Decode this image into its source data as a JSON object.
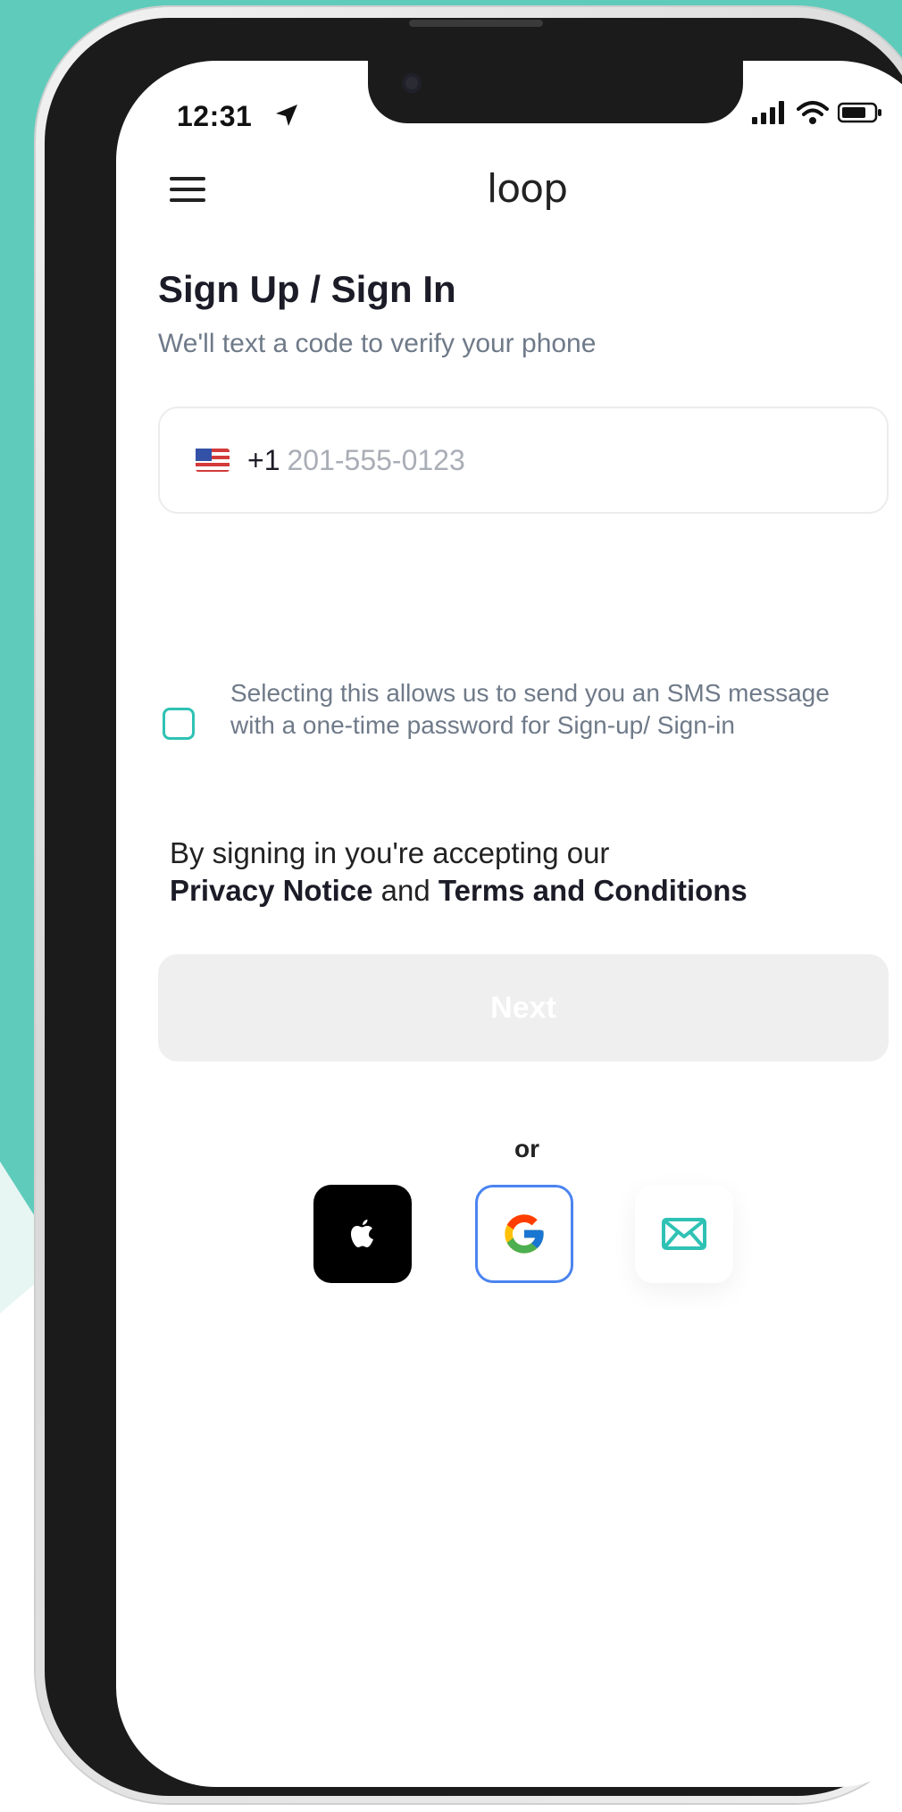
{
  "status_bar": {
    "time": "12:31"
  },
  "header": {
    "logo_text": "loop"
  },
  "auth": {
    "title": "Sign Up / Sign In",
    "subtitle": "We'll text a code to verify your phone",
    "phone": {
      "country_code": "+1",
      "placeholder": "201-555-0123",
      "value": ""
    },
    "sms_consent": {
      "checked": false,
      "text": "Selecting this allows us to send you an SMS message with a one-time password for Sign-up/ Sign-in"
    },
    "legal": {
      "prefix": "By signing in you're accepting our",
      "privacy_label": "Privacy Notice",
      "joiner": "and",
      "terms_label": "Terms and Conditions"
    },
    "next_label": "Next",
    "or_label": "or"
  },
  "colors": {
    "teal": "#5fcbbb",
    "accent": "#2fc2b4",
    "google_border": "#4b84f0",
    "disabled_button": "#efefef"
  },
  "icons": {
    "menu": "hamburger-icon",
    "location": "location-arrow-icon",
    "signal": "signal-icon",
    "wifi": "wifi-icon",
    "battery": "battery-icon",
    "flag": "us-flag-icon",
    "apple": "apple-icon",
    "google": "google-icon",
    "email": "email-icon"
  }
}
